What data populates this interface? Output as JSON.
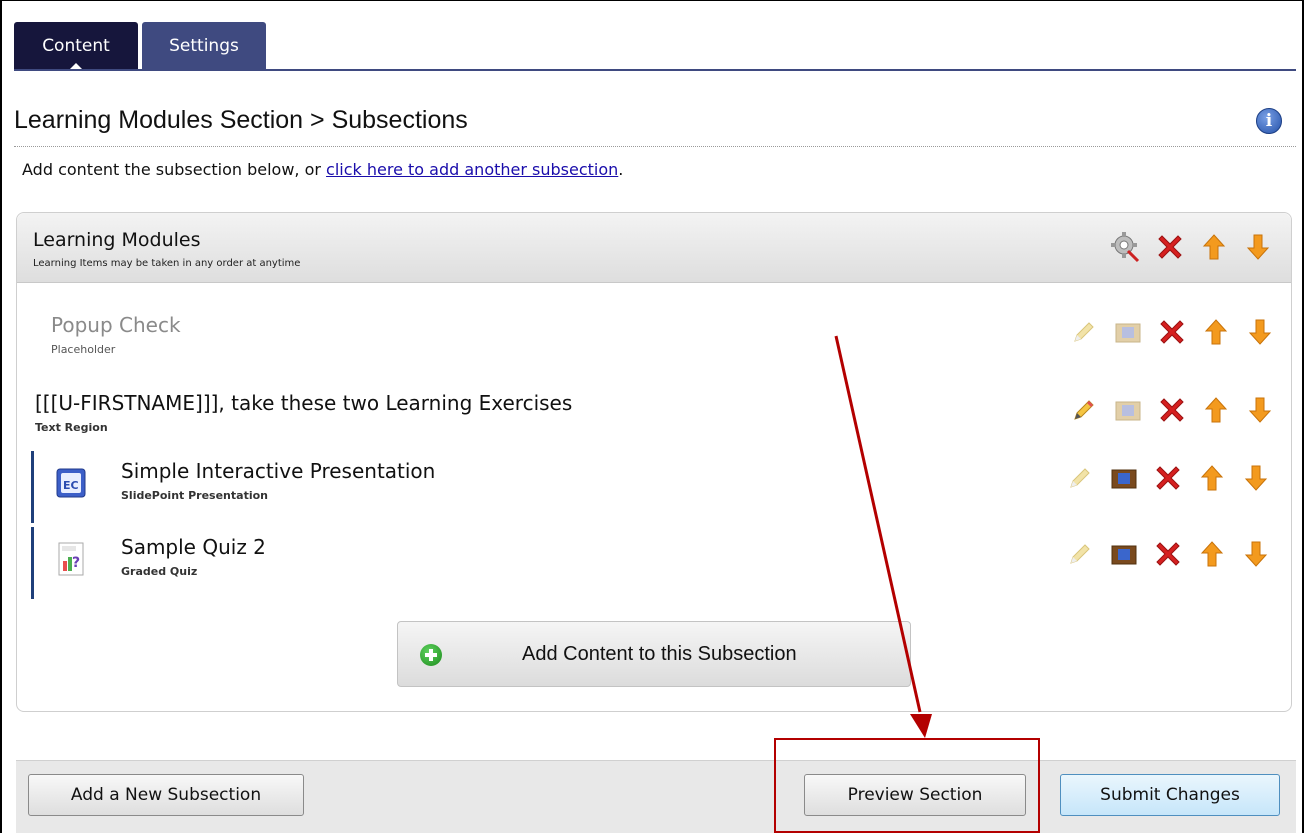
{
  "tabs": [
    {
      "label": "Content",
      "active": true
    },
    {
      "label": "Settings",
      "active": false
    }
  ],
  "page_title": "Learning Modules Section > Subsections",
  "instructions": {
    "prefix": "Add content the subsection below, or ",
    "link": "click here to add another subsection",
    "suffix": "."
  },
  "panel": {
    "title": "Learning Modules",
    "subtitle": "Learning Items may be taken in any order at anytime",
    "header_icons": [
      "settings-gear-icon",
      "delete-x-icon",
      "move-up-arrow-icon",
      "move-down-arrow-icon"
    ],
    "items": [
      {
        "title": "Popup Check",
        "type": "Placeholder",
        "style": "placeholder"
      },
      {
        "title": "[[[U-FIRSTNAME]]], take these two Learning Exercises",
        "type": "Text Region",
        "style": "text"
      },
      {
        "title": "Simple Interactive Presentation",
        "type": "SlidePoint Presentation",
        "style": "presentation"
      },
      {
        "title": "Sample Quiz 2",
        "type": "Graded Quiz",
        "style": "quiz"
      }
    ],
    "add_content_label": "Add Content to this Subsection"
  },
  "footer": {
    "add_subsection": "Add a New Subsection",
    "preview": "Preview Section",
    "submit": "Submit Changes"
  },
  "colors": {
    "tab_active": "#16163c",
    "tab_inactive": "#3f4a80",
    "delete_red": "#d62020",
    "arrow_orange": "#f39a1e",
    "annotation_red": "#b30000"
  }
}
